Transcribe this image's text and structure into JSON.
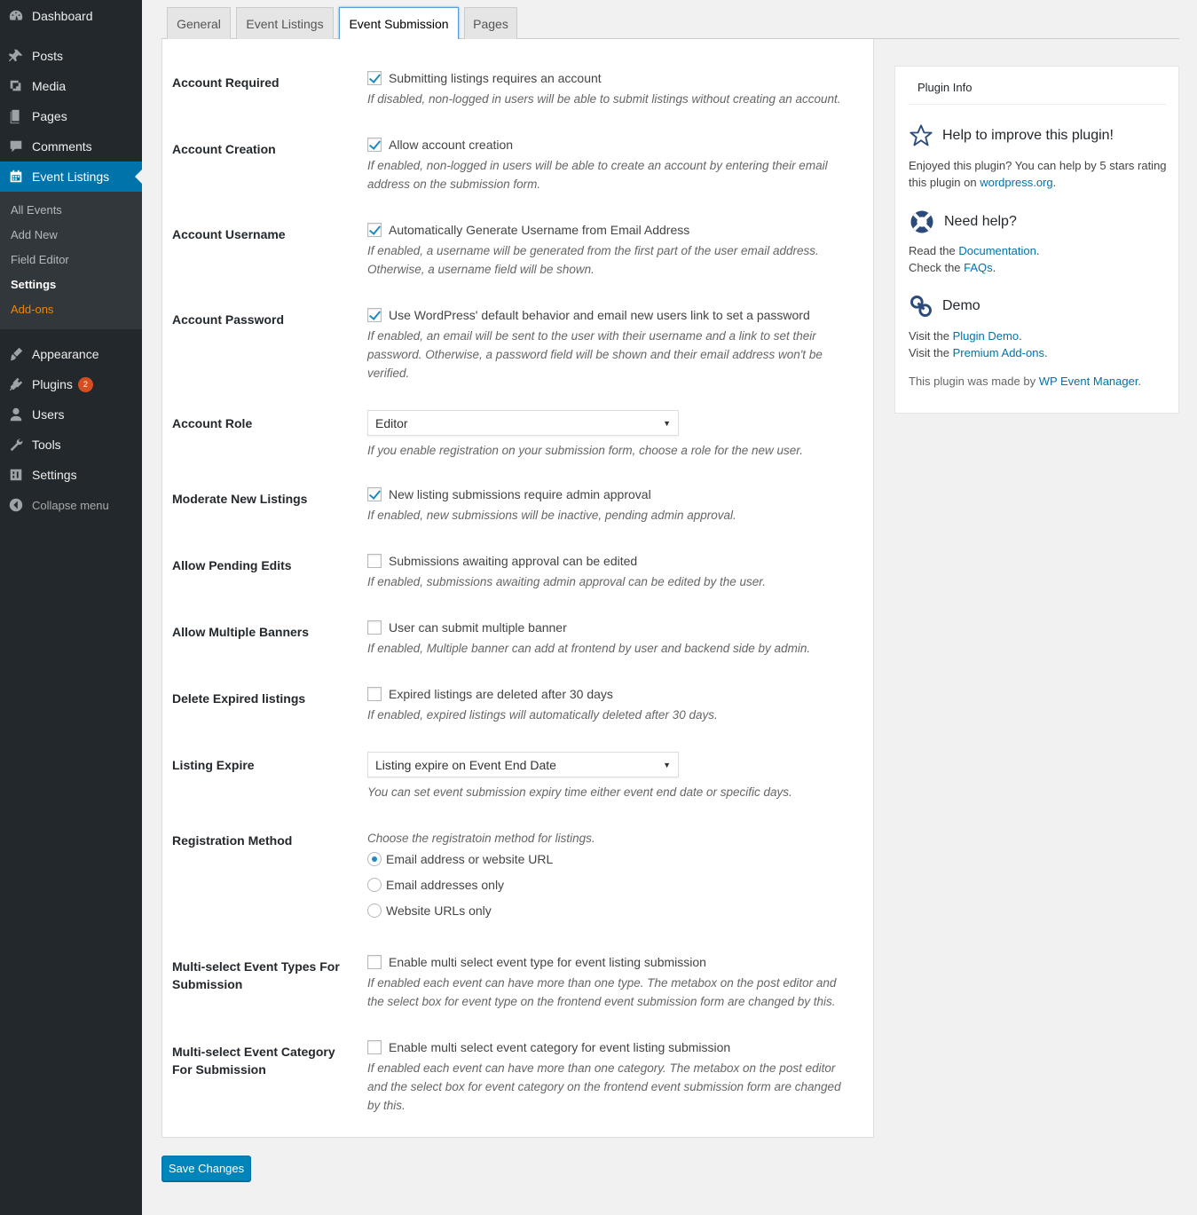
{
  "sidebar": {
    "items": [
      {
        "label": "Dashboard",
        "icon": "dashboard-icon"
      },
      {
        "label": "Posts",
        "icon": "pin-icon"
      },
      {
        "label": "Media",
        "icon": "media-icon"
      },
      {
        "label": "Pages",
        "icon": "pages-icon"
      },
      {
        "label": "Comments",
        "icon": "comments-icon"
      },
      {
        "label": "Event Listings",
        "icon": "calendar-icon"
      },
      {
        "label": "Appearance",
        "icon": "brush-icon"
      },
      {
        "label": "Plugins",
        "icon": "plugin-icon",
        "badge": "2"
      },
      {
        "label": "Users",
        "icon": "users-icon"
      },
      {
        "label": "Tools",
        "icon": "wrench-icon"
      },
      {
        "label": "Settings",
        "icon": "settings-icon"
      },
      {
        "label": "Collapse menu",
        "icon": "collapse-icon"
      }
    ],
    "submenu": [
      "All Events",
      "Add New",
      "Field Editor",
      "Settings",
      "Add-ons"
    ]
  },
  "tabs": [
    "General",
    "Event Listings",
    "Event Submission",
    "Pages"
  ],
  "rows": [
    {
      "label": "Account Required",
      "check": "Submitting listings requires an account",
      "desc": "If disabled, non-logged in users will be able to submit listings without creating an account."
    },
    {
      "label": "Account Creation",
      "check": "Allow account creation",
      "desc1": "If enabled, non-logged in users will be able to create an account by entering their email",
      "desc2": "address on the submission form."
    },
    {
      "label": "Account Username",
      "check": "Automatically Generate Username from Email Address",
      "desc1": "If enabled, a username will be generated from the first part of the user email address.",
      "desc2": "Otherwise, a username field will be shown."
    },
    {
      "label": "Account Password",
      "check": "Use WordPress' default behavior and email new users link to set a password",
      "desc1": "If enabled, an email will be sent to the user with their username and a link to set their",
      "desc2": "password. Otherwise, a password field will be shown and their email address won't be",
      "desc3": "verified."
    },
    {
      "label": "Account Role",
      "select": "Editor",
      "desc": "If you enable registration on your submission form, choose a role for the new user."
    },
    {
      "label": "Moderate New Listings",
      "check": "New listing submissions require admin approval",
      "desc": "If enabled, new submissions will be inactive, pending admin approval."
    },
    {
      "label": "Allow Pending Edits",
      "check": "Submissions awaiting approval can be edited",
      "desc": "If enabled, submissions awaiting admin approval can be edited by the user."
    },
    {
      "label": "Allow Multiple Banners",
      "check": "User can submit multiple banner",
      "desc": "If enabled, Multiple banner can add at frontend by user and backend side by admin."
    },
    {
      "label": "Delete Expired listings",
      "check": "Expired listings are deleted after 30 days",
      "desc": "If enabled, expired listings will automatically deleted after 30 days."
    },
    {
      "label": "Listing Expire",
      "select": "Listing expire on Event End Date",
      "desc": "You can set event submission expiry time either event end date or specific days."
    },
    {
      "label": "Registration Method",
      "intro": "Choose the registratoin method for listings.",
      "radios": [
        "Email address or website URL",
        "Email addresses only",
        "Website URLs only"
      ]
    },
    {
      "label1": "Multi-select Event Types For",
      "label2": "Submission",
      "check": "Enable multi select event type for event listing submission",
      "desc1": "If enabled each event can have more than one type. The metabox on the post editor and",
      "desc2": "the select box for event type on the frontend event submission form are changed by this."
    },
    {
      "label1": "Multi-select Event Category",
      "label2": "For Submission",
      "check": "Enable multi select event category for event listing submission",
      "desc1": "If enabled each event can have more than one category. The metabox on the post editor",
      "desc2": "and the select box for event category on the frontend event submission form are changed",
      "desc3": "by this."
    }
  ],
  "checked": [
    true,
    true,
    true,
    true,
    null,
    true,
    false,
    false,
    false,
    null,
    null,
    false,
    false
  ],
  "save_label": "Save Changes",
  "info": {
    "title": "Plugin Info",
    "improve": {
      "heading": "Help to improve this plugin!",
      "text1": "Enjoyed this plugin? You can help by 5 stars rating",
      "text2a": "this plugin on ",
      "link": "wordpress.org",
      "text2b": "."
    },
    "help": {
      "heading": "Need help?",
      "read": "Read the ",
      "doc_link": "Documentation",
      "dot1": ".",
      "check": "Check the ",
      "faq_link": "FAQs",
      "dot2": "."
    },
    "demo": {
      "heading": "Demo",
      "visit1": "Visit the ",
      "demo_link": "Plugin Demo",
      "dot1": ".",
      "visit2": "Visit the ",
      "addons_link": "Premium Add-ons",
      "dot2": "."
    },
    "made": {
      "text": "This plugin was made by ",
      "link": "WP Event Manager",
      "dot": "."
    }
  }
}
